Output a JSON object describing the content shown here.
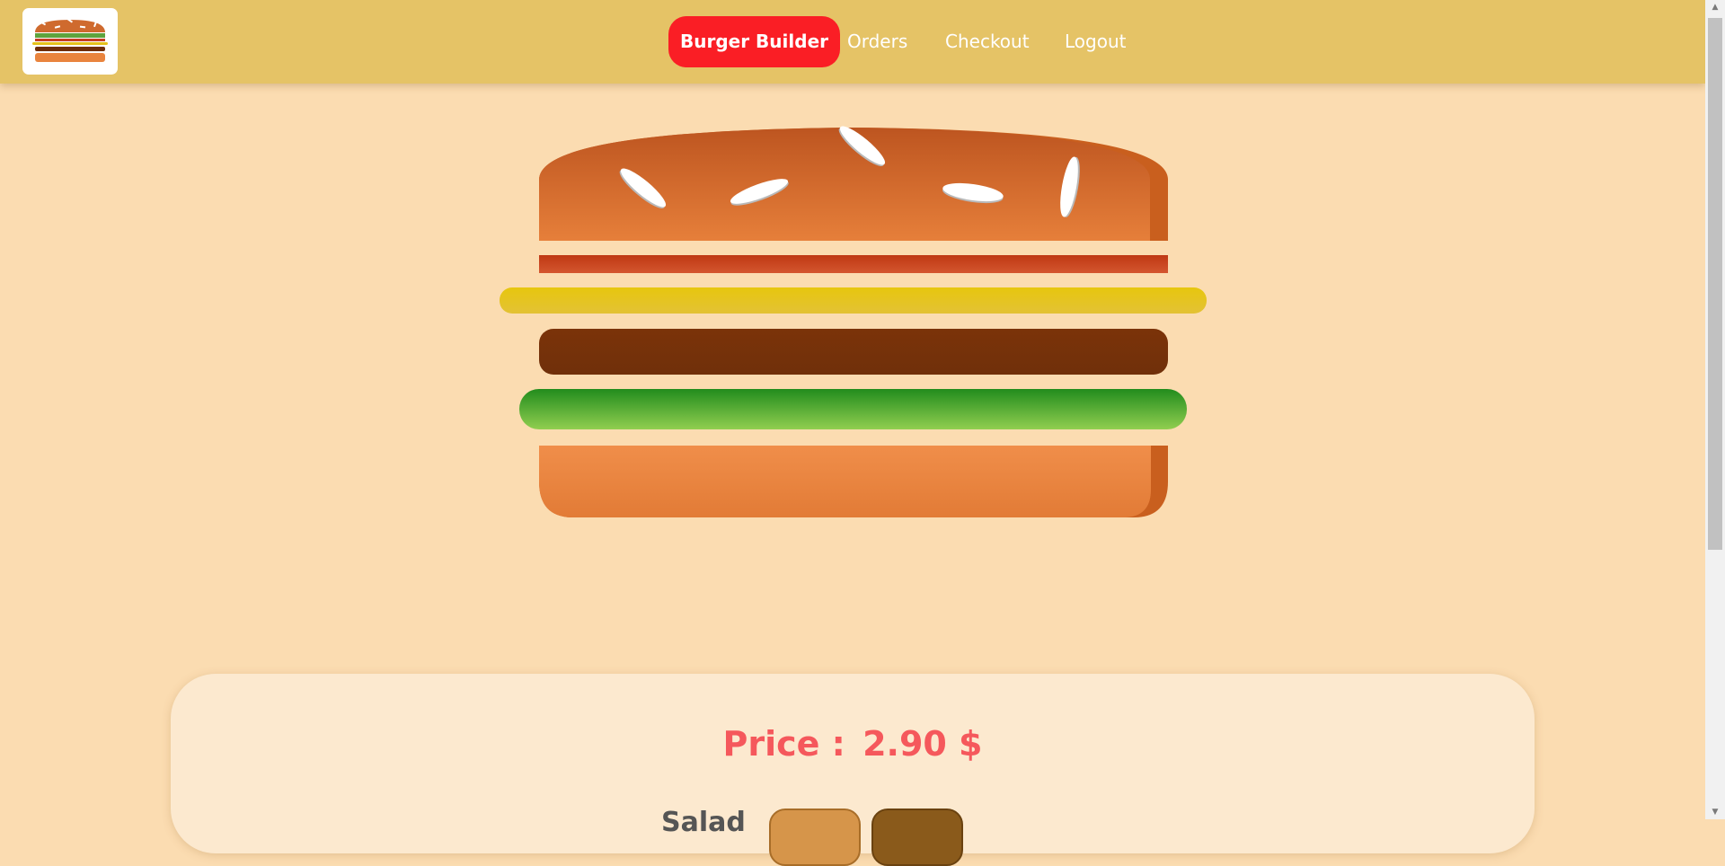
{
  "navbar": {
    "logo_icon": "burger-logo-icon",
    "items": [
      {
        "label": "Burger Builder",
        "active": true
      },
      {
        "label": "Orders",
        "active": false
      },
      {
        "label": "Checkout",
        "active": false
      },
      {
        "label": "Logout",
        "active": false
      }
    ]
  },
  "burger": {
    "ingredients": [
      "bread-top",
      "bacon",
      "cheese",
      "meat",
      "salad",
      "bread-bottom"
    ]
  },
  "build_controls": {
    "price_label": "Price :",
    "price_value": "2.90 $",
    "partial_label": "Salad"
  },
  "colors": {
    "navbar_bg": "#e5c366",
    "page_bg": "#fbdcb1",
    "active_nav": "#fa1e25",
    "price_text": "#f5585c",
    "panel_bg": "#fce9cf"
  }
}
